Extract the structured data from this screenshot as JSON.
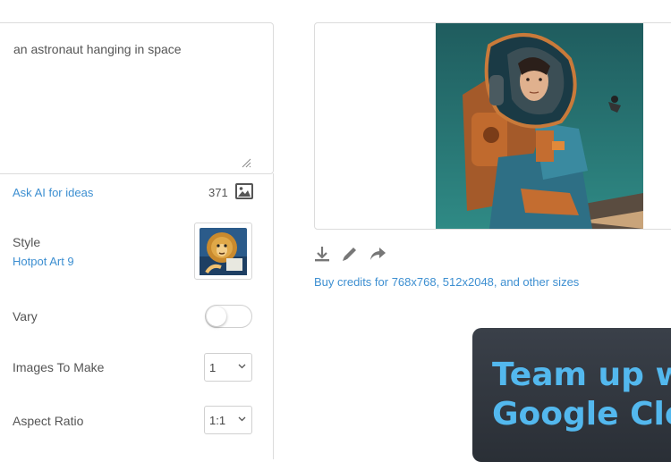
{
  "prompt": {
    "text": "an astronaut hanging in space"
  },
  "prompt_footer": {
    "ask_ai_label": "Ask AI for ideas",
    "char_count": "371",
    "icon": "image-icon"
  },
  "style": {
    "label": "Style",
    "value": "Hotpot Art 9",
    "thumbnail": "lion-artwork"
  },
  "vary": {
    "label": "Vary",
    "enabled": false
  },
  "images_to_make": {
    "label": "Images To Make",
    "selected": "1"
  },
  "aspect_ratio": {
    "label": "Aspect Ratio",
    "selected": "1:1"
  },
  "result": {
    "image_subject": "astronaut-illustration",
    "actions": [
      "download-icon",
      "edit-icon",
      "share-icon"
    ],
    "buy_credits_text": "Buy credits for 768x768, 512x2048, and other sizes"
  },
  "ad": {
    "line1": "Team up wi",
    "line2": "Google Clou"
  },
  "colors": {
    "link": "#3d8fd1",
    "ad_text": "#53b8ee",
    "ad_bg": "#2f343b"
  }
}
